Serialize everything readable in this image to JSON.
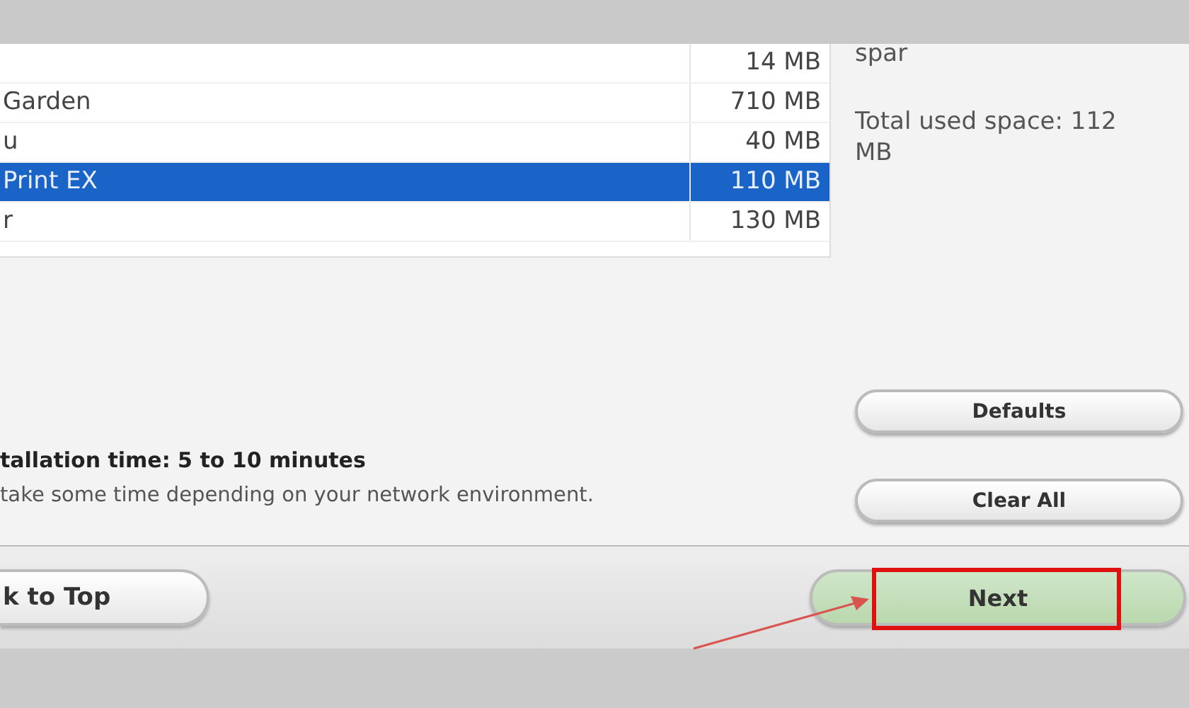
{
  "software_list": {
    "rows": [
      {
        "name": "",
        "size": "14 MB",
        "selected": false
      },
      {
        "name": "Garden",
        "size": "710 MB",
        "selected": false
      },
      {
        "name": "u",
        "size": "40 MB",
        "selected": false
      },
      {
        "name": "Print EX",
        "size": "110 MB",
        "selected": true
      },
      {
        "name": "r",
        "size": "130 MB",
        "selected": false
      }
    ]
  },
  "disk_info": [
    "spar",
    "Total used space: 112 MB"
  ],
  "install_time": {
    "title": "tallation time: 5 to 10 minutes",
    "note": "take some time depending on your network environment."
  },
  "side_buttons": [
    "Defaults",
    "Clear All"
  ],
  "footer": {
    "back_button": "k to Top",
    "next_button": {
      "label": "Next",
      "highlighted": true
    }
  }
}
